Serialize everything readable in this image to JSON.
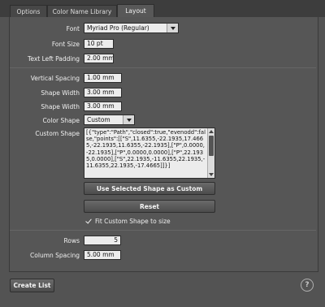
{
  "tabs": [
    {
      "label": "Options"
    },
    {
      "label": "Color Name Library"
    },
    {
      "label": "Layout"
    }
  ],
  "font": {
    "label": "Font",
    "value": "Myriad Pro (Regular)"
  },
  "font_size": {
    "label": "Font Size",
    "value": "10 pt"
  },
  "text_left_padding": {
    "label": "Text Left Padding",
    "value": "2.00 mm"
  },
  "vertical_spacing": {
    "label": "Vertical Spacing",
    "value": "1.00 mm"
  },
  "shape_width_1": {
    "label": "Shape Width",
    "value": "3.00 mm"
  },
  "shape_width_2": {
    "label": "Shape Width",
    "value": "3.00 mm"
  },
  "color_shape": {
    "label": "Color Shape",
    "value": "Custom"
  },
  "custom_shape": {
    "label": "Custom Shape",
    "value": "[{\"type\":\"Path\",\"closed\":true,\"evenodd\":false,\"points\":[[\"S\",11.6355,-22.1935,17.4665,-22.1935,11.6355,-22.1935],[\"P\",0.0000,-22.1935],[\"P\",0.0000,0.0000],[\"P\",22.1935,0.0000],[\"S\",22.1935,-11.6355,22.1935,-11.6355,22.1935,-17.4665]]}]"
  },
  "buttons": {
    "use_selected": "Use Selected Shape as Custom",
    "reset": "Reset",
    "create_list": "Create List"
  },
  "fit_custom": {
    "label": "Fit Custom Shape to size",
    "checked": true
  },
  "rows": {
    "label": "Rows",
    "value": "5"
  },
  "column_spacing": {
    "label": "Column Spacing",
    "value": "5.00 mm"
  },
  "help": {
    "glyph": "?"
  }
}
